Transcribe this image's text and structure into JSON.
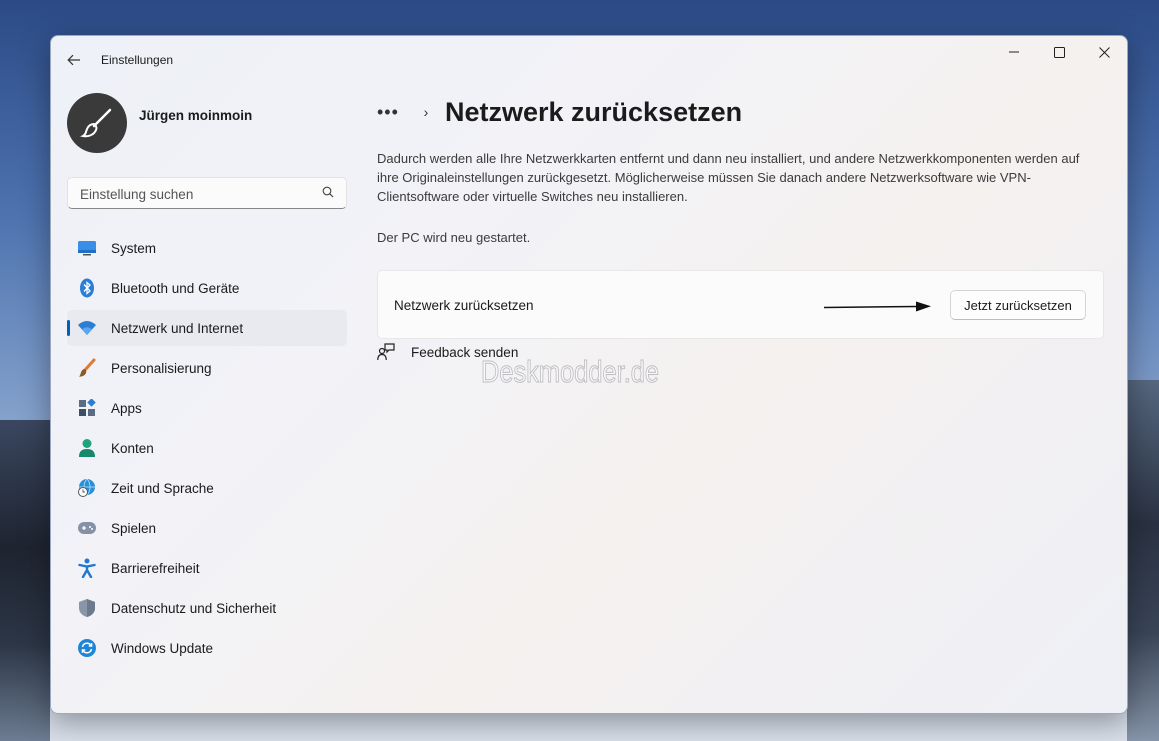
{
  "window": {
    "title": "Einstellungen"
  },
  "user": {
    "name": "Jürgen moinmoin"
  },
  "search": {
    "placeholder": "Einstellung suchen"
  },
  "sidebar": {
    "items": [
      {
        "label": "System",
        "icon": "system-icon"
      },
      {
        "label": "Bluetooth und Geräte",
        "icon": "bluetooth-icon"
      },
      {
        "label": "Netzwerk und Internet",
        "icon": "wifi-icon",
        "active": true
      },
      {
        "label": "Personalisierung",
        "icon": "brush-icon"
      },
      {
        "label": "Apps",
        "icon": "apps-icon"
      },
      {
        "label": "Konten",
        "icon": "account-icon"
      },
      {
        "label": "Zeit und Sprache",
        "icon": "globe-clock-icon"
      },
      {
        "label": "Spielen",
        "icon": "gamepad-icon"
      },
      {
        "label": "Barrierefreiheit",
        "icon": "accessibility-icon"
      },
      {
        "label": "Datenschutz und Sicherheit",
        "icon": "shield-icon"
      },
      {
        "label": "Windows Update",
        "icon": "update-icon"
      }
    ]
  },
  "breadcrumb": {
    "more": "•••",
    "separator": "›"
  },
  "page": {
    "title": "Netzwerk zurücksetzen",
    "description": "Dadurch werden alle Ihre Netzwerkkarten entfernt und dann neu installiert, und andere Netzwerkkomponenten werden auf ihre Originaleinstellungen zurückgesetzt. Möglicherweise müssen Sie danach andere Netzwerksoftware wie VPN-Clientsoftware oder virtuelle Switches neu installieren.",
    "restart_note": "Der PC wird neu gestartet.",
    "card_label": "Netzwerk zurücksetzen",
    "reset_button": "Jetzt zurücksetzen",
    "feedback": "Feedback senden"
  },
  "watermark": "Deskmodder.de",
  "colors": {
    "accent": "#005fb8",
    "window_bg": "#f3f3f3"
  }
}
